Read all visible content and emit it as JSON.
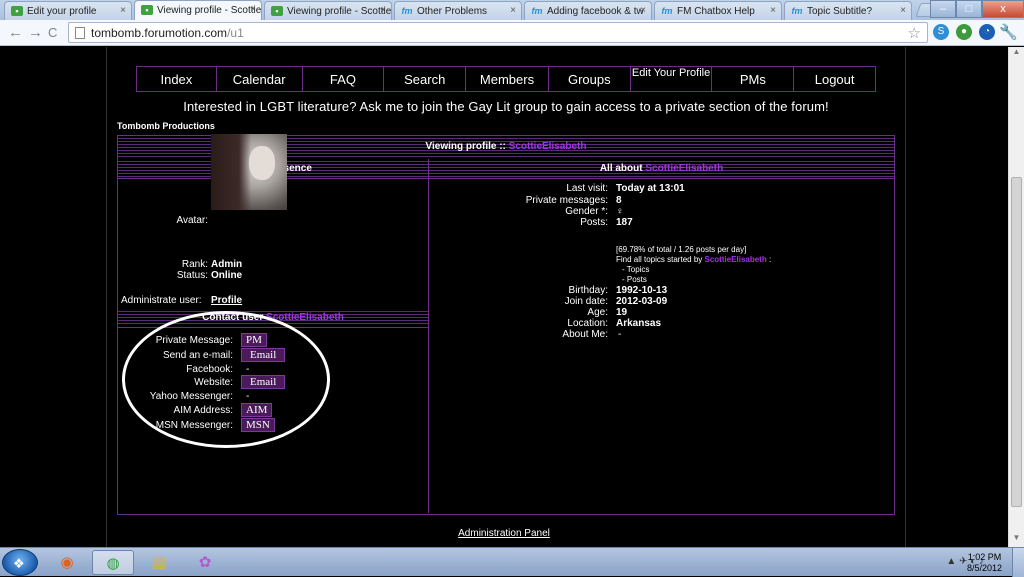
{
  "browser": {
    "tabs": [
      {
        "title": "Edit your profile",
        "icon": "forum-icon"
      },
      {
        "title": "Viewing profile - Scottie",
        "icon": "forum-icon"
      },
      {
        "title": "Viewing profile - Scottie",
        "icon": "forum-icon"
      },
      {
        "title": "Other Problems",
        "icon": "fm-icon"
      },
      {
        "title": "Adding facebook & tw",
        "icon": "fm-icon"
      },
      {
        "title": "FM Chatbox Help",
        "icon": "fm-icon"
      },
      {
        "title": "Topic Subtitle?",
        "icon": "fm-icon"
      }
    ],
    "tab_close": "×",
    "url_domain": "tombomb.forumotion.com",
    "url_path": "/u1",
    "back": "←",
    "forward": "→",
    "reload": "C",
    "star": "☆",
    "wrench": "🔧",
    "win_min": "–",
    "win_max": "□",
    "win_close": "x"
  },
  "nav": [
    "Index",
    "Calendar",
    "FAQ",
    "Search",
    "Members",
    "Groups",
    "Edit Your Profile",
    "PMs",
    "Logout"
  ],
  "announcement": "Interested in LGBT literature? Ask me to join the Gay Lit group to gain access to a private section of the forum!",
  "site_name": "Tombomb Productions",
  "profile": {
    "header_prefix": "Viewing profile :: ",
    "username": "ScottieElisabeth",
    "forum_presence_header": "Forum presence",
    "all_about_prefix": "All about ",
    "avatar_label": "Avatar:",
    "rank_label": "Rank:",
    "rank": "Admin",
    "status_label": "Status:",
    "status": "Online",
    "administrate_label": "Administrate user:",
    "administrate_link": "Profile",
    "contact_header_prefix": "Contact user ",
    "contact": {
      "private_message_label": "Private Message:",
      "private_message_btn": "PM",
      "email_label": "Send an e-mail:",
      "email_btn": "Email",
      "facebook_label": "Facebook:",
      "facebook_value": "-",
      "website_label": "Website:",
      "website_btn": "Email",
      "yahoo_label": "Yahoo Messenger:",
      "yahoo_value": "-",
      "aim_label": "AIM Address:",
      "aim_btn": "AIM",
      "msn_label": "MSN Messenger:",
      "msn_btn": "MSN"
    },
    "about": {
      "last_visit_label": "Last visit:",
      "last_visit": "Today at 13:01",
      "pm_label": "Private messages:",
      "pm_count": "8",
      "gender_label": "Gender *:",
      "gender": "♀",
      "posts_label": "Posts:",
      "posts": "187",
      "posts_stats": "[69.78% of total / 1.26 posts per day]",
      "find_topics_prefix": "Find all topics started by ",
      "find_topics_suffix": " :",
      "topics_link": "- Topics",
      "posts_link": "- Posts",
      "birthday_label": "Birthday:",
      "birthday": "1992-10-13",
      "join_label": "Join date:",
      "join_date": "2012-03-09",
      "age_label": "Age:",
      "age": "19",
      "location_label": "Location:",
      "location": "Arkansas",
      "about_me_label": "About Me:",
      "about_me": "-"
    }
  },
  "footer": {
    "admin_panel": "Administration Panel"
  },
  "taskbar": {
    "time": "1:02 PM",
    "date": "8/5/2012"
  },
  "colors": {
    "accent_purple": "#a035e6",
    "border_purple": "#6a2e88",
    "background": "#000000"
  }
}
